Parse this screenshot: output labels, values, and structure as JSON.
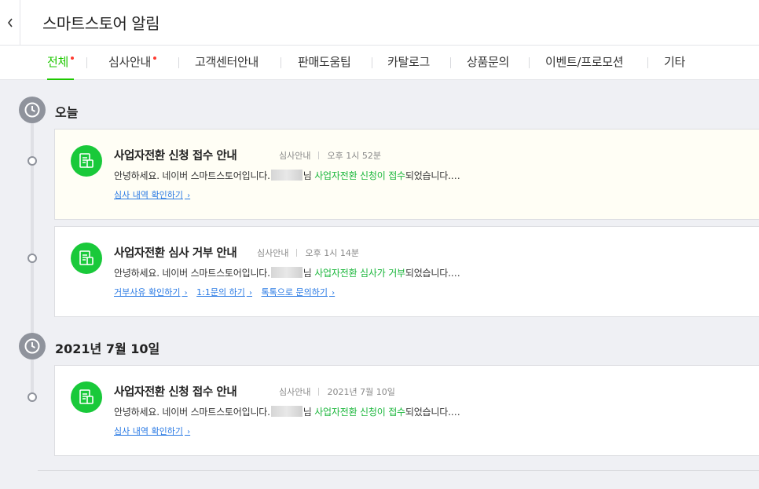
{
  "header": {
    "title": "스마트스토어 알림",
    "back_icon": "chevron-left-icon"
  },
  "tabs": [
    {
      "label": "전체",
      "new": true,
      "active": true
    },
    {
      "label": "심사안내",
      "new": true,
      "active": false
    },
    {
      "label": "고객센터안내",
      "new": false,
      "active": false
    },
    {
      "label": "판매도움팁",
      "new": false,
      "active": false
    },
    {
      "label": "카탈로그",
      "new": false,
      "active": false
    },
    {
      "label": "상품문의",
      "new": false,
      "active": false
    },
    {
      "label": "이벤트/프로모션",
      "new": false,
      "active": false
    },
    {
      "label": "기타",
      "new": false,
      "active": false
    }
  ],
  "groups": [
    {
      "date": "오늘",
      "items": [
        {
          "title": "사업자전환 신청 접수 안내",
          "category": "심사안내",
          "time": "오후 1시 52분",
          "body_prefix": "안녕하세요. 네이버 스마트스토어입니다.",
          "body_suffix": "님",
          "body_green1": "사업자전환 신청이",
          "body_green2": "접수",
          "body_end": "되었습니다.…",
          "links": [
            "심사 내역 확인하기"
          ]
        },
        {
          "title": "사업자전환 심사 거부 안내",
          "category": "심사안내",
          "time": "오후 1시 14분",
          "body_prefix": "안녕하세요. 네이버 스마트스토어입니다.",
          "body_suffix": "님",
          "body_green1": "사업자전환 심사가",
          "body_green2": "거부",
          "body_end": "되었습니다.…",
          "links": [
            "거부사유 확인하기",
            "1:1문의 하기",
            "톡톡으로 문의하기"
          ]
        }
      ]
    },
    {
      "date": "2021년 7월 10일",
      "items": [
        {
          "title": "사업자전환 신청 접수 안내",
          "category": "심사안내",
          "time": "2021년 7월 10일",
          "body_prefix": "안녕하세요. 네이버 스마트스토어입니다.",
          "body_suffix": "님",
          "body_green1": "사업자전환 신청이",
          "body_green2": "접수",
          "body_end": "되었습니다.…",
          "links": [
            "심사 내역 확인하기"
          ]
        }
      ]
    }
  ],
  "colors": {
    "accent": "#1ec800",
    "icon_green": "#19c93a",
    "link_blue": "#2a7ae4",
    "new_dot": "#ff3b30",
    "highlight_bg": "#fffef5"
  }
}
